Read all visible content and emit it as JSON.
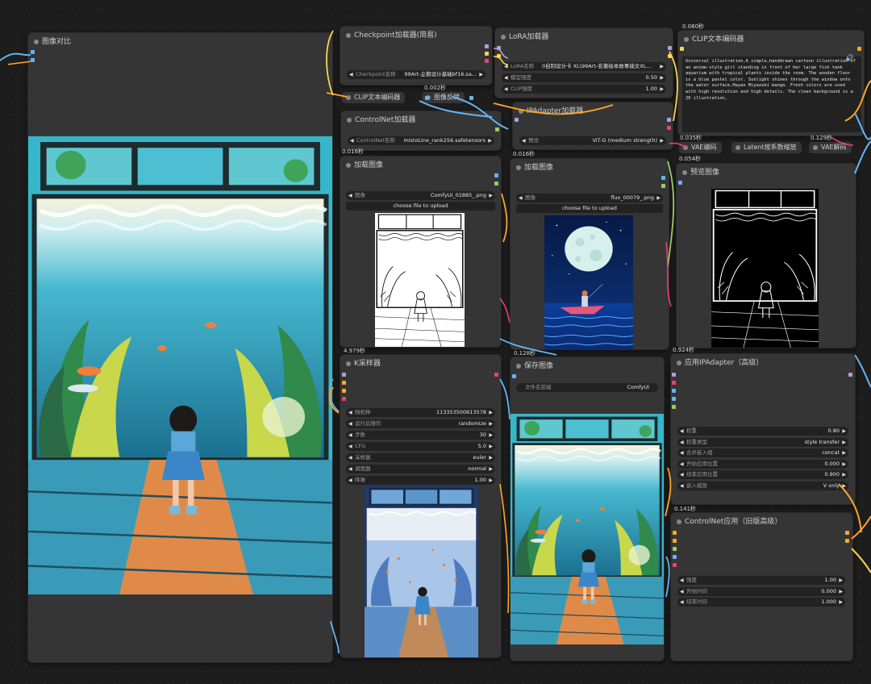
{
  "colors": {
    "canvas": "#1d1d1d",
    "node": "#353535",
    "widget": "#222222",
    "wire_blue": "#64b5f6",
    "wire_orange": "#ffa726",
    "wire_pink": "#ec407a",
    "wire_yellow": "#ffd54f",
    "wire_lime": "#9ccc65",
    "wire_purple": "#b39ddb"
  },
  "nodes": {
    "compare": {
      "title": "图像对比"
    },
    "checkpoint": {
      "title": "Checkpoint加载器(简易)",
      "ckpt_label": "Checkpoint名称",
      "ckpt_value": "99Art-企鹅设计基础bf16.sa..."
    },
    "lora": {
      "title": "LoRA加载器",
      "lora_label": "LoRA名称",
      "lora_value": "0自制设计卡 XL\\99Art-名著绘本故事插文XL...",
      "model_strength_label": "模型强度",
      "model_strength_value": "0.50",
      "clip_strength_label": "CLIP强度",
      "clip_strength_value": "1.00"
    },
    "clip_top": {
      "timing": "0.060秒",
      "title": "CLIP文本编码器",
      "text": "Universal illustration,A simple,handdrawn cartoon illustration of an anime-style girl standing in front of her large fish tank aquarium with tropical plants inside the room. The wooden floor is a blue pastel color. Sunlight shines through the window onto the water surface.Hayao Miyazaki manga. Fresh colors are used with high resolution and high details. The clean background is a 2D illustration,"
    },
    "clip_mid": {
      "title": "CLIP文本编码器"
    },
    "invert": {
      "timing": "0.002秒",
      "title": "图像反转"
    },
    "controlnet_loader": {
      "title": "ControlNet加载器",
      "name_label": "ControlNet名称",
      "name_value": "mistoLine_rank256.safetensors"
    },
    "ipadapter_loader": {
      "title": "IPAdapter加载器",
      "preset_label": "预设",
      "preset_value": "ViT-G (medium strength)"
    },
    "vae_encode": {
      "timing": "0.035秒",
      "title": "VAE编码"
    },
    "latent_scale": {
      "title": "Latent按系数缩放"
    },
    "vae_decode": {
      "timing": "0.129秒",
      "title": "VAE解码"
    },
    "load_image_1": {
      "timing": "0.016秒",
      "title": "加载图像",
      "image_label": "图像",
      "image_value": "ComfyUI_01885_.png",
      "upload": "choose file to upload"
    },
    "load_image_2": {
      "timing": "0.016秒",
      "title": "加载图像",
      "image_label": "图像",
      "image_value": "flux_00079_.png",
      "upload": "choose file to upload"
    },
    "preview": {
      "timing": "0.054秒",
      "title": "预览图像"
    },
    "ksampler": {
      "timing": "4.979秒",
      "title": "K采样器",
      "rows": [
        {
          "label": "随机种",
          "value": "113353500613578"
        },
        {
          "label": "运行后操作",
          "value": "randomize"
        },
        {
          "label": "步数",
          "value": "30"
        },
        {
          "label": "CFG",
          "value": "5.0"
        },
        {
          "label": "采样器",
          "value": "euler"
        },
        {
          "label": "调度器",
          "value": "normal"
        },
        {
          "label": "降噪",
          "value": "1.00"
        }
      ]
    },
    "save": {
      "timing": "0.128秒",
      "title": "保存图像",
      "prefix_label": "文件名前缀",
      "prefix_value": "ComfyUI"
    },
    "apply_ipadapter": {
      "timing": "0.924秒",
      "title": "应用IPAdapter（高级）",
      "rows": [
        {
          "label": "权重",
          "value": "0.80"
        },
        {
          "label": "权重类型",
          "value": "style transfer"
        },
        {
          "label": "合并嵌入组",
          "value": "concat"
        },
        {
          "label": "开始应用位置",
          "value": "0.000"
        },
        {
          "label": "结束应用位置",
          "value": "0.900"
        },
        {
          "label": "嵌入缩放",
          "value": "V only"
        }
      ]
    },
    "apply_controlnet": {
      "timing": "0.141秒",
      "title": "ControlNet应用（旧版高级）",
      "rows": [
        {
          "label": "强度",
          "value": "1.00"
        },
        {
          "label": "开始时间",
          "value": "0.000"
        },
        {
          "label": "结束时间",
          "value": "1.000"
        }
      ]
    }
  }
}
